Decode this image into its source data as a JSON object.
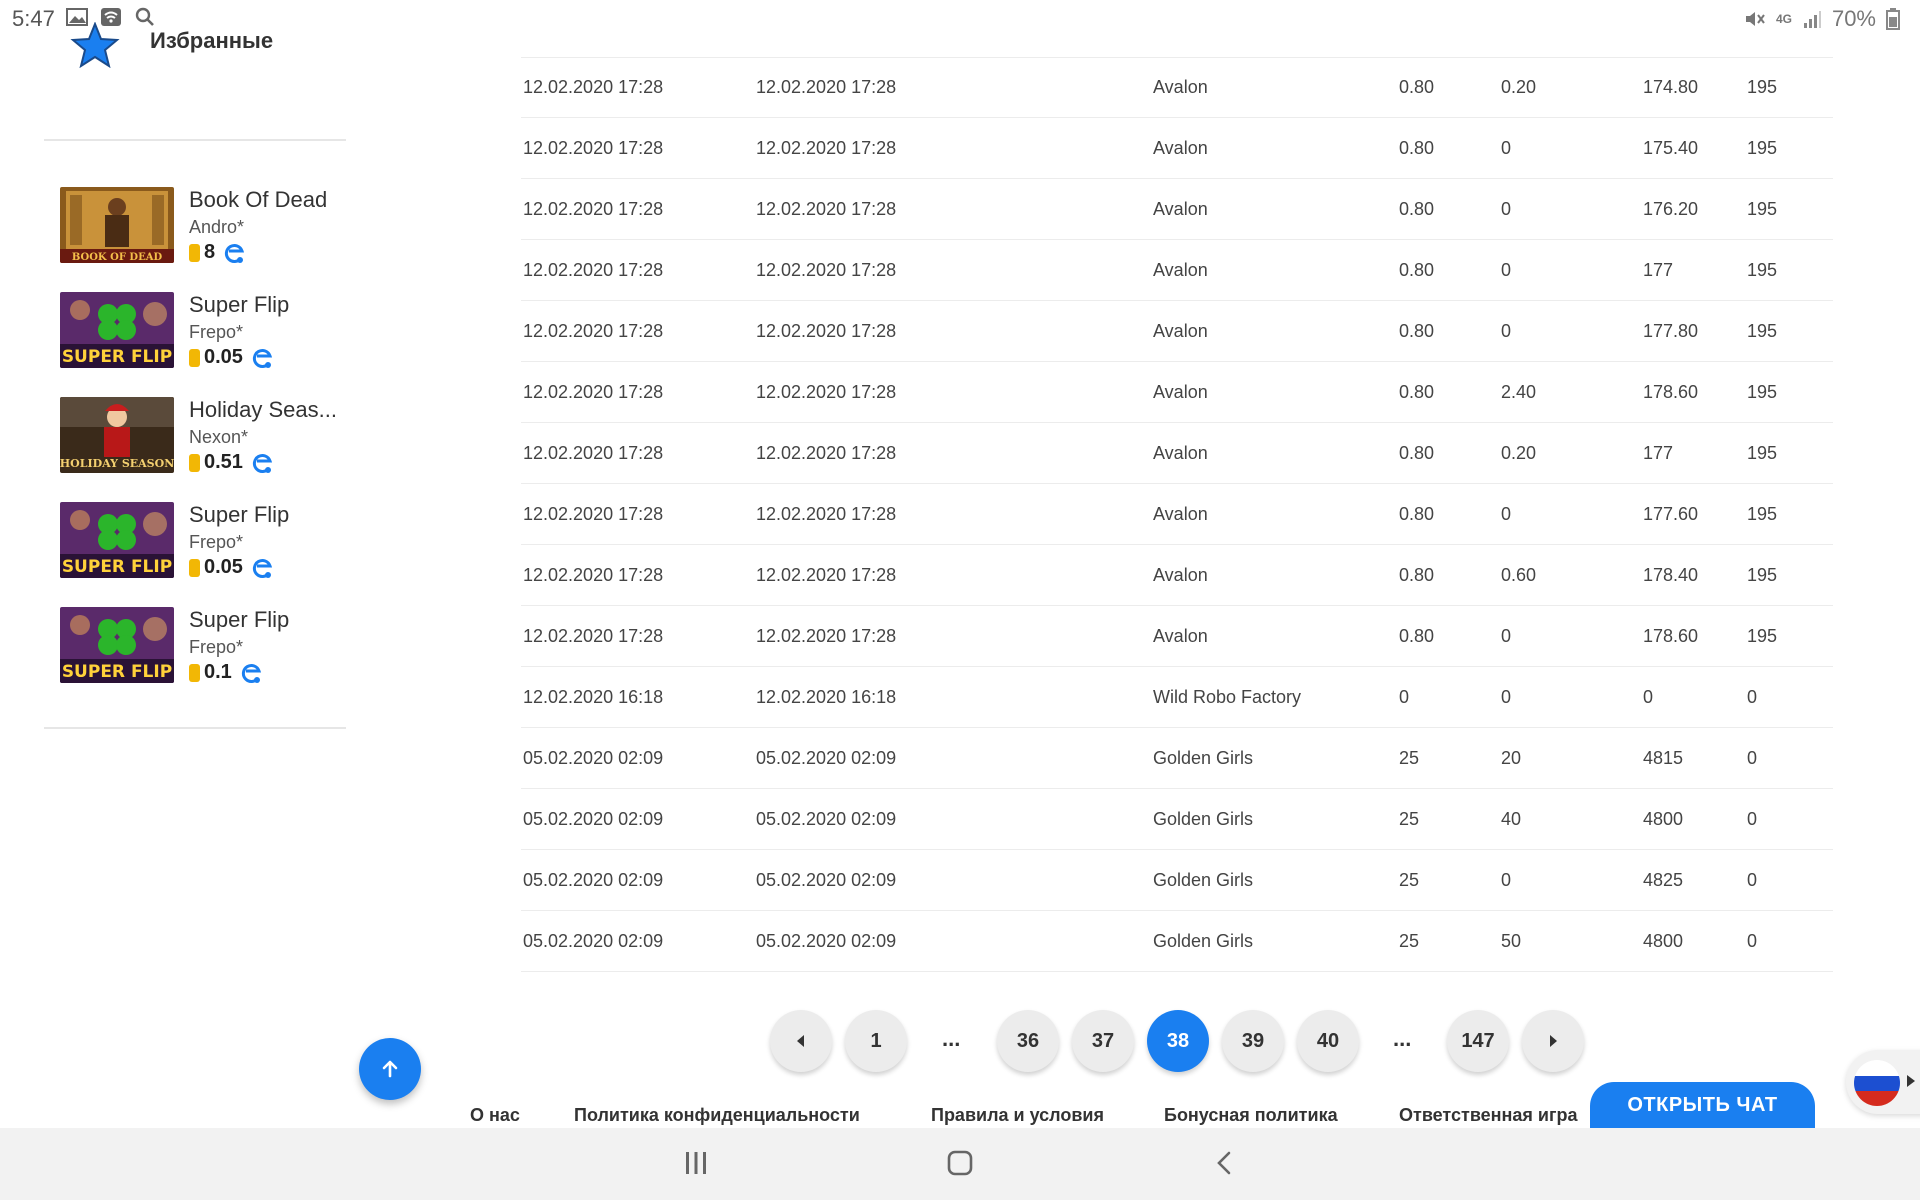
{
  "status_bar": {
    "time": "5:47",
    "battery": "70%",
    "network": "4G"
  },
  "sidebar": {
    "favorites_title": "Избранные",
    "games": [
      {
        "name": "Book Of Dead",
        "provider": "Andro*",
        "value": "8"
      },
      {
        "name": "Super Flip",
        "provider": "Frepo*",
        "value": "0.05"
      },
      {
        "name": "Holiday Seas...",
        "provider": "Nexon*",
        "value": "0.51"
      },
      {
        "name": "Super Flip",
        "provider": "Frepo*",
        "value": "0.05"
      },
      {
        "name": "Super Flip",
        "provider": "Frepo*",
        "value": "0.1"
      }
    ]
  },
  "table": {
    "rows": [
      [
        "12.02.2020 17:28",
        "12.02.2020 17:28",
        "Avalon",
        "0.80",
        "0.20",
        "174.80",
        "195"
      ],
      [
        "12.02.2020 17:28",
        "12.02.2020 17:28",
        "Avalon",
        "0.80",
        "0",
        "175.40",
        "195"
      ],
      [
        "12.02.2020 17:28",
        "12.02.2020 17:28",
        "Avalon",
        "0.80",
        "0",
        "176.20",
        "195"
      ],
      [
        "12.02.2020 17:28",
        "12.02.2020 17:28",
        "Avalon",
        "0.80",
        "0",
        "177",
        "195"
      ],
      [
        "12.02.2020 17:28",
        "12.02.2020 17:28",
        "Avalon",
        "0.80",
        "0",
        "177.80",
        "195"
      ],
      [
        "12.02.2020 17:28",
        "12.02.2020 17:28",
        "Avalon",
        "0.80",
        "2.40",
        "178.60",
        "195"
      ],
      [
        "12.02.2020 17:28",
        "12.02.2020 17:28",
        "Avalon",
        "0.80",
        "0.20",
        "177",
        "195"
      ],
      [
        "12.02.2020 17:28",
        "12.02.2020 17:28",
        "Avalon",
        "0.80",
        "0",
        "177.60",
        "195"
      ],
      [
        "12.02.2020 17:28",
        "12.02.2020 17:28",
        "Avalon",
        "0.80",
        "0.60",
        "178.40",
        "195"
      ],
      [
        "12.02.2020 17:28",
        "12.02.2020 17:28",
        "Avalon",
        "0.80",
        "0",
        "178.60",
        "195"
      ],
      [
        "12.02.2020 16:18",
        "12.02.2020 16:18",
        "Wild Robo Factory",
        "0",
        "0",
        "0",
        "0"
      ],
      [
        "05.02.2020 02:09",
        "05.02.2020 02:09",
        "Golden Girls",
        "25",
        "20",
        "4815",
        "0"
      ],
      [
        "05.02.2020 02:09",
        "05.02.2020 02:09",
        "Golden Girls",
        "25",
        "40",
        "4800",
        "0"
      ],
      [
        "05.02.2020 02:09",
        "05.02.2020 02:09",
        "Golden Girls",
        "25",
        "0",
        "4825",
        "0"
      ],
      [
        "05.02.2020 02:09",
        "05.02.2020 02:09",
        "Golden Girls",
        "25",
        "50",
        "4800",
        "0"
      ]
    ]
  },
  "pagination": {
    "first": "1",
    "ellipsis": "...",
    "pages": [
      "36",
      "37",
      "38",
      "39",
      "40"
    ],
    "current": "38",
    "last": "147"
  },
  "footer": {
    "links": [
      "О нас",
      "Политика конфиденциальности",
      "Правила и условия",
      "Бонусная политика",
      "Ответственная игра"
    ],
    "chat_button": "ОТКРЫТЬ ЧАТ"
  },
  "colors": {
    "accent": "#1a7ff0",
    "coin": "#f2b705"
  }
}
